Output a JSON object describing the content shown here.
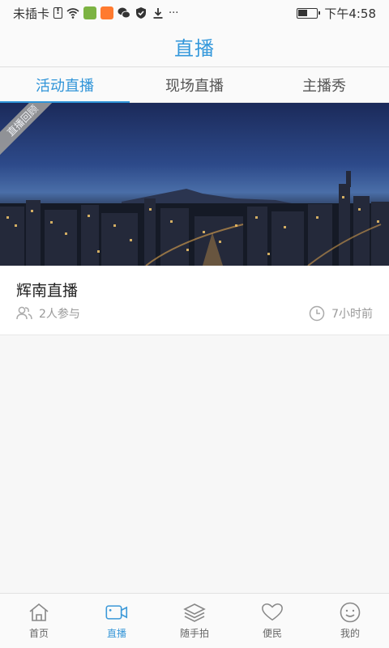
{
  "status_bar": {
    "carrier": "未插卡",
    "time": "下午4:58",
    "more": "···"
  },
  "header": {
    "title": "直播"
  },
  "tabs": [
    {
      "label": "活动直播",
      "active": true
    },
    {
      "label": "现场直播",
      "active": false
    },
    {
      "label": "主播秀",
      "active": false
    }
  ],
  "live_card": {
    "ribbon": "直播回顾",
    "title": "辉南直播",
    "participants": "2人参与",
    "time_ago": "7小时前"
  },
  "bottom_nav": [
    {
      "label": "首页",
      "icon": "home-icon",
      "active": false
    },
    {
      "label": "直播",
      "icon": "video-camera-icon",
      "active": true
    },
    {
      "label": "随手拍",
      "icon": "layers-icon",
      "active": false
    },
    {
      "label": "便民",
      "icon": "heart-icon",
      "active": false
    },
    {
      "label": "我的",
      "icon": "smiley-icon",
      "active": false
    }
  ],
  "colors": {
    "accent": "#2f94d8",
    "inactive_text": "#666666",
    "meta_text": "#999999"
  }
}
